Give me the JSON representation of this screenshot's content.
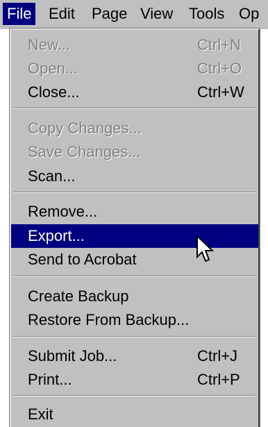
{
  "menubar": {
    "items": [
      {
        "label": "File",
        "active": true
      },
      {
        "label": "Edit"
      },
      {
        "label": "Page"
      },
      {
        "label": "View"
      },
      {
        "label": "Tools"
      },
      {
        "label": "Op"
      }
    ]
  },
  "file_menu": {
    "new": {
      "label": "New...",
      "shortcut": "Ctrl+N",
      "disabled": true
    },
    "open": {
      "label": "Open...",
      "shortcut": "Ctrl+O",
      "disabled": true
    },
    "close": {
      "label": "Close...",
      "shortcut": "Ctrl+W"
    },
    "copy_changes": {
      "label": "Copy Changes...",
      "disabled": true
    },
    "save_changes": {
      "label": "Save Changes...",
      "disabled": true
    },
    "scan": {
      "label": "Scan..."
    },
    "remove": {
      "label": "Remove..."
    },
    "export": {
      "label": "Export...",
      "highlighted": true
    },
    "send_to_acrobat": {
      "label": "Send to Acrobat"
    },
    "create_backup": {
      "label": "Create Backup"
    },
    "restore_from_backup": {
      "label": "Restore From Backup..."
    },
    "submit_job": {
      "label": "Submit Job...",
      "shortcut": "Ctrl+J"
    },
    "print": {
      "label": "Print...",
      "shortcut": "Ctrl+P"
    },
    "exit": {
      "label": "Exit"
    }
  },
  "colors": {
    "menu_bg": "#c0c0c0",
    "highlight": "#000080",
    "disabled_text": "#808080"
  },
  "icons": {
    "cursor": "arrow-pointer-icon"
  }
}
